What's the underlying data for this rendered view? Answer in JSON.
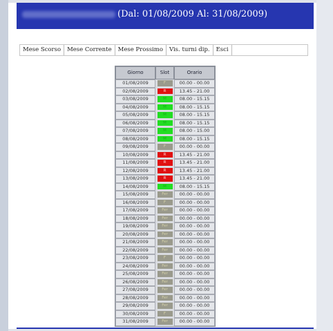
{
  "header": {
    "range": "(Dal: 01/08/2009 Al: 31/08/2009)"
  },
  "menu": [
    "Mese Scorso",
    "Mese Corrente",
    "Mese Prossimo",
    "Vis. turni dip.",
    "Esci"
  ],
  "table": {
    "headers": {
      "giorno": "Giorno",
      "slot": "Slot",
      "orario": "Orario"
    },
    "colors": {
      "R": "#e01010",
      "M": "#22dd22",
      "F": "#9a9a8c",
      "Fer": "#9a9a8c"
    },
    "rows": [
      {
        "date": "01/08/2009",
        "slot": "F",
        "time": "00.00 - 00.00"
      },
      {
        "date": "02/08/2009",
        "slot": "R",
        "time": "13.45 - 21.00"
      },
      {
        "date": "03/08/2009",
        "slot": "M",
        "time": "08.00 - 15.15"
      },
      {
        "date": "04/08/2009",
        "slot": "M",
        "time": "08.00 - 15.15"
      },
      {
        "date": "05/08/2009",
        "slot": "M",
        "time": "08.00 - 15.15"
      },
      {
        "date": "06/08/2009",
        "slot": "M",
        "time": "08.00 - 15.15"
      },
      {
        "date": "07/08/2009",
        "slot": "M",
        "time": "08.00 - 15.00"
      },
      {
        "date": "08/08/2009",
        "slot": "M",
        "time": "08.00 - 15.15"
      },
      {
        "date": "09/08/2009",
        "slot": "F",
        "time": "00.00 - 00.00"
      },
      {
        "date": "10/08/2009",
        "slot": "R",
        "time": "13.45 - 21.00"
      },
      {
        "date": "11/08/2009",
        "slot": "R",
        "time": "13.45 - 21.00"
      },
      {
        "date": "12/08/2009",
        "slot": "R",
        "time": "13.45 - 21.00"
      },
      {
        "date": "13/08/2009",
        "slot": "R",
        "time": "13.45 - 21.00"
      },
      {
        "date": "14/08/2009",
        "slot": "M",
        "time": "08.00 - 15.15"
      },
      {
        "date": "15/08/2009",
        "slot": "Fer",
        "time": "00.00 - 00.00"
      },
      {
        "date": "16/08/2009",
        "slot": "F",
        "time": "00.00 - 00.00"
      },
      {
        "date": "17/08/2009",
        "slot": "Fer",
        "time": "00.00 - 00.00"
      },
      {
        "date": "18/08/2009",
        "slot": "Fer",
        "time": "00.00 - 00.00"
      },
      {
        "date": "19/08/2009",
        "slot": "Fer",
        "time": "00.00 - 00.00"
      },
      {
        "date": "20/08/2009",
        "slot": "Fer",
        "time": "00.00 - 00.00"
      },
      {
        "date": "21/08/2009",
        "slot": "Fer",
        "time": "00.00 - 00.00"
      },
      {
        "date": "22/08/2009",
        "slot": "Fer",
        "time": "00.00 - 00.00"
      },
      {
        "date": "23/08/2009",
        "slot": "F",
        "time": "00.00 - 00.00"
      },
      {
        "date": "24/08/2009",
        "slot": "Fer",
        "time": "00.00 - 00.00"
      },
      {
        "date": "25/08/2009",
        "slot": "Fer",
        "time": "00.00 - 00.00"
      },
      {
        "date": "26/08/2009",
        "slot": "Fer",
        "time": "00.00 - 00.00"
      },
      {
        "date": "27/08/2009",
        "slot": "Fer",
        "time": "00.00 - 00.00"
      },
      {
        "date": "28/08/2009",
        "slot": "Fer",
        "time": "00.00 - 00.00"
      },
      {
        "date": "29/08/2009",
        "slot": "Fer",
        "time": "00.00 - 00.00"
      },
      {
        "date": "30/08/2009",
        "slot": "F",
        "time": "00.00 - 00.00"
      },
      {
        "date": "31/08/2009",
        "slot": "Fer",
        "time": "00.00 - 00.00"
      }
    ]
  }
}
